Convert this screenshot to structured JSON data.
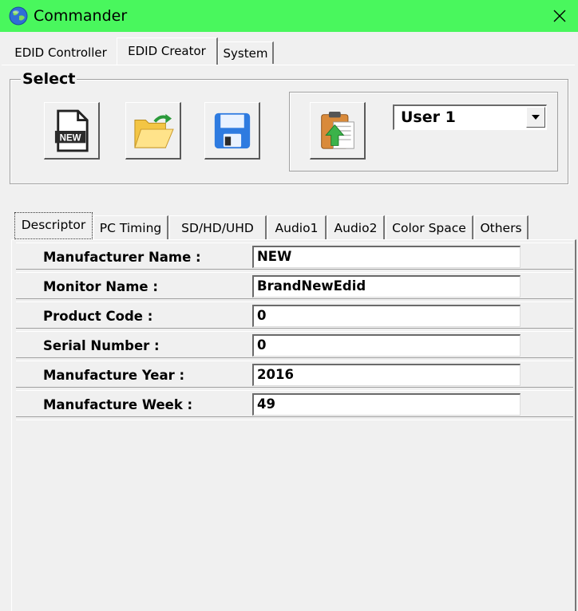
{
  "window": {
    "title": "Commander",
    "accent": "#49f75d"
  },
  "main_tabs": [
    {
      "label": "EDID Controller"
    },
    {
      "label": "EDID Creator"
    },
    {
      "label": "System"
    }
  ],
  "select_group": {
    "label": "Select",
    "buttons": [
      {
        "name": "new-edid-button",
        "icon": "new-file-icon",
        "icon_text": "NEW"
      },
      {
        "name": "open-button",
        "icon": "open-folder-icon"
      },
      {
        "name": "save-button",
        "icon": "floppy-disk-icon"
      },
      {
        "name": "upload-button",
        "icon": "clipboard-upload-icon"
      }
    ],
    "user_select": {
      "value": "User 1"
    }
  },
  "sub_tabs": [
    {
      "label": "Descriptor"
    },
    {
      "label": "PC Timing"
    },
    {
      "label": "SD/HD/UHD"
    },
    {
      "label": "Audio1"
    },
    {
      "label": "Audio2"
    },
    {
      "label": "Color Space"
    },
    {
      "label": "Others"
    }
  ],
  "descriptor": {
    "rows": [
      {
        "label": "Manufacturer Name :",
        "value": "NEW"
      },
      {
        "label": "Monitor Name :",
        "value": "BrandNewEdid"
      },
      {
        "label": "Product Code :",
        "value": "0"
      },
      {
        "label": "Serial Number :",
        "value": "0"
      },
      {
        "label": "Manufacture Year :",
        "value": "2016"
      },
      {
        "label": "Manufacture Week :",
        "value": "49"
      }
    ]
  }
}
